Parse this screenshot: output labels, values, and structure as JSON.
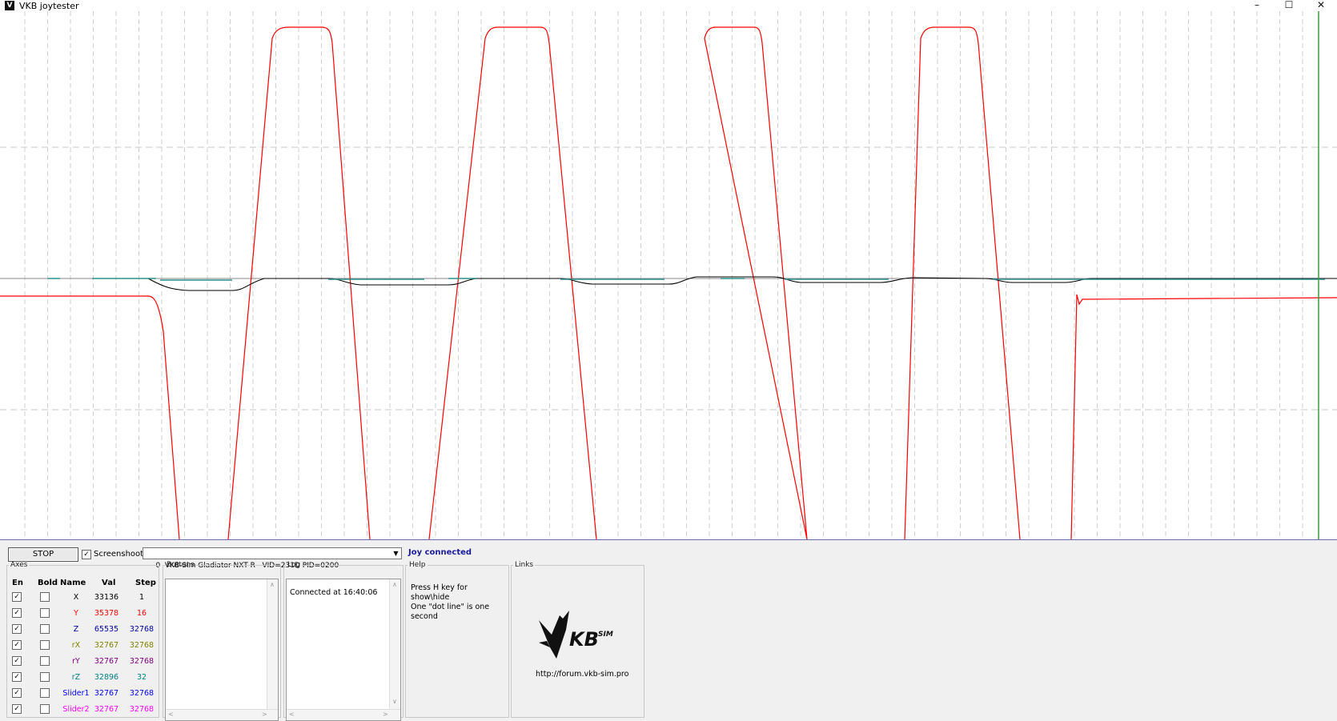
{
  "window": {
    "title": "VKB joytester",
    "app_icon_glyph": "V",
    "controls": {
      "minimize": "–",
      "maximize": "☐",
      "close": "✕"
    }
  },
  "plot": {
    "background": "#ffffff",
    "center_line_color": "#888888",
    "cursor_color": "#3c9e3c",
    "traces": [
      {
        "axis": "Y",
        "color": "#ff0000"
      },
      {
        "axis": "X",
        "color": "#000000"
      },
      {
        "axis": "rZ",
        "color": "#2f8f8f"
      }
    ]
  },
  "controls": {
    "stop_label": "STOP",
    "screenshot_label": "Screenshoot",
    "screenshot_checked": "✓",
    "device": "0  VKB-Sim Gladiator NXT R   VID=231D PID=0200",
    "dropdown_arrow": "▼",
    "status": "Joy connected"
  },
  "axes": {
    "title": "Axes",
    "headers": {
      "en": "En",
      "bold": "Bold",
      "name": "Name",
      "val": "Val",
      "step": "Step"
    },
    "rows": [
      {
        "en": "✓",
        "name": "X",
        "val": "33136",
        "step": "1",
        "color": "#000000"
      },
      {
        "en": "✓",
        "name": "Y",
        "val": "35378",
        "step": "16",
        "color": "#ff0000"
      },
      {
        "en": "✓",
        "name": "Z",
        "val": "65535",
        "step": "32768",
        "color": "#0000a0"
      },
      {
        "en": "✓",
        "name": "rX",
        "val": "32767",
        "step": "32768",
        "color": "#808000"
      },
      {
        "en": "✓",
        "name": "rY",
        "val": "32767",
        "step": "32768",
        "color": "#800080"
      },
      {
        "en": "✓",
        "name": "rZ",
        "val": "32896",
        "step": "32",
        "color": "#008080"
      },
      {
        "en": "✓",
        "name": "Slider1",
        "val": "32767",
        "step": "32768",
        "color": "#0000ff"
      },
      {
        "en": "✓",
        "name": "Slider2",
        "val": "32767",
        "step": "32768",
        "color": "#ff00ff"
      }
    ]
  },
  "buttons": {
    "title": "Buttons"
  },
  "log": {
    "title": "Log",
    "lines": [
      "Connected at 16:40:06"
    ]
  },
  "help": {
    "title": "Help",
    "lines": [
      "Press H key for show\\hide",
      "One \"dot line\" is one second"
    ]
  },
  "links": {
    "title": "Links",
    "logo_text": "KB",
    "logo_sup": "SIM",
    "url": "http://forum.vkb-sim.pro"
  }
}
